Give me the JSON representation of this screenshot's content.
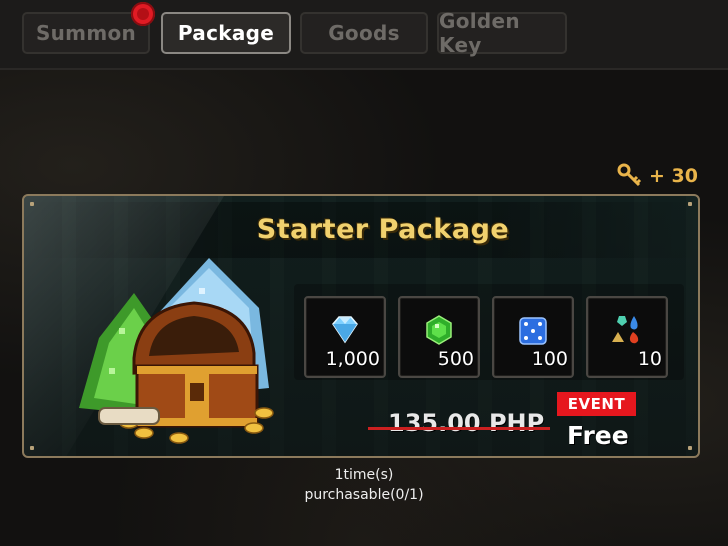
{
  "tabs": [
    {
      "label": "Summon",
      "active": false,
      "has_notification": true
    },
    {
      "label": "Package",
      "active": true,
      "has_notification": false
    },
    {
      "label": "Goods",
      "active": false,
      "has_notification": false
    },
    {
      "label": "Golden Key",
      "active": false,
      "has_notification": false
    }
  ],
  "key_reward": {
    "icon": "golden-key-icon",
    "text": "+ 30"
  },
  "package": {
    "title": "Starter Package",
    "items": [
      {
        "icon": "diamond-icon",
        "quantity": "1,000"
      },
      {
        "icon": "green-gem-icon",
        "quantity": "500"
      },
      {
        "icon": "blue-dice-icon",
        "quantity": "100"
      },
      {
        "icon": "element-stones-icon",
        "quantity": "10"
      }
    ],
    "original_price": "135.00 PHP",
    "event_label": "EVENT",
    "price": "Free"
  },
  "purchase_limit": {
    "line1": "1time(s)",
    "line2": "purchasable(0/1)"
  },
  "colors": {
    "title_gold": "#f1d16e",
    "event_red": "#e6171e",
    "key_gold": "#e9b44a",
    "notification_red": "#e01b24"
  }
}
